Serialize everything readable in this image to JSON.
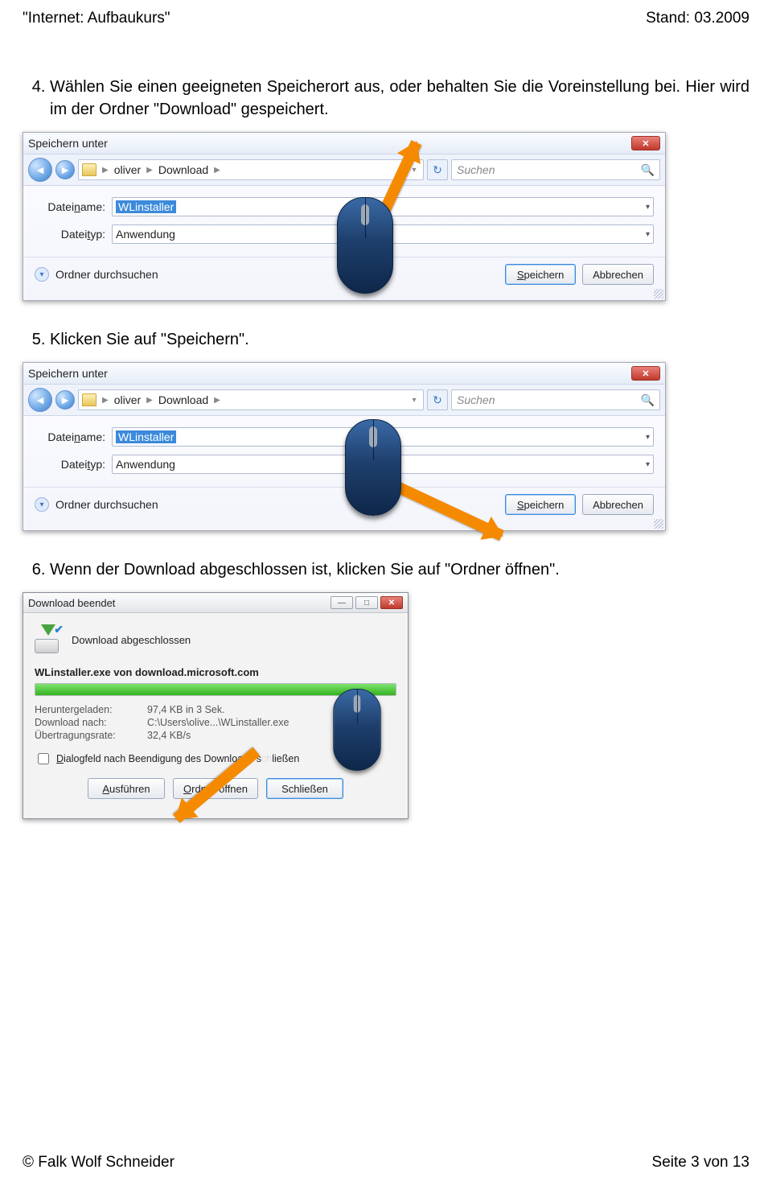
{
  "page": {
    "header_left": "\"Internet: Aufbaukurs\"",
    "header_right": "Stand: 03.2009",
    "footer_left": "© Falk Wolf Schneider",
    "footer_right": "Seite 3 von 13"
  },
  "steps": {
    "s4": "Wählen Sie einen geeigneten Speicherort aus, oder behalten Sie die Voreinstellung bei. Hier wird im der Ordner \"Download\" gespeichert.",
    "s5": "Klicken Sie auf \"Speichern\".",
    "s6": "Wenn der Download abgeschlossen ist, klicken Sie auf \"Ordner öffnen\"."
  },
  "saveDlg": {
    "title": "Speichern unter",
    "breadcrumb": {
      "p1": "oliver",
      "p2": "Download"
    },
    "search_placeholder": "Suchen",
    "label_name": "Dateiname:",
    "filename": "WLinstaller",
    "label_type": "Dateityp:",
    "filetype": "Anwendung",
    "browse_folders": "Ordner durchsuchen",
    "btn_save": "Speichern",
    "btn_cancel": "Abbrechen"
  },
  "dlDlg": {
    "title": "Download beendet",
    "status": "Download abgeschlossen",
    "source": "WLinstaller.exe von download.microsoft.com",
    "lbl_downloaded": "Heruntergeladen:",
    "val_downloaded": "97,4 KB in 3 Sek.",
    "lbl_dest": "Download nach:",
    "val_dest": "C:\\Users\\olive...\\WLinstaller.exe",
    "lbl_rate": "Übertragungsrate:",
    "val_rate": "32,4 KB/s",
    "chk_text_pre": "Dialogfeld nach Beendigung des Downloads ",
    "chk_text_post": "ließen",
    "btn_run": "Ausführen",
    "btn_open": "Ordner öffnen",
    "btn_close": "Schließen"
  }
}
